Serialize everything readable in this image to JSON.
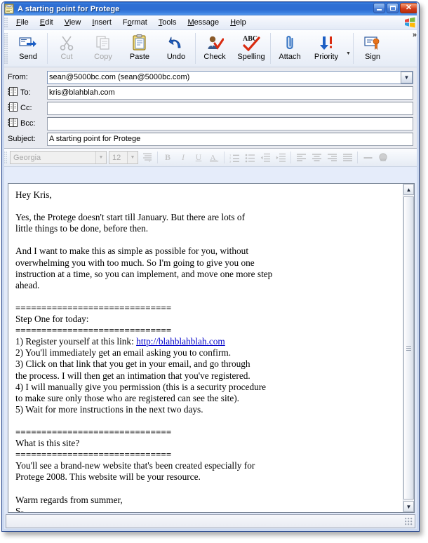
{
  "window": {
    "title": "A starting point for Protege",
    "icon": "mail-compose-icon",
    "controls": {
      "minimize": "minimize-button",
      "maximize": "maximize-button",
      "close": "close-button"
    }
  },
  "menubar": {
    "items": [
      {
        "label": "File",
        "mnemonic": "F"
      },
      {
        "label": "Edit",
        "mnemonic": "E"
      },
      {
        "label": "View",
        "mnemonic": "V"
      },
      {
        "label": "Insert",
        "mnemonic": "I"
      },
      {
        "label": "Format",
        "mnemonic": "o"
      },
      {
        "label": "Tools",
        "mnemonic": "T"
      },
      {
        "label": "Message",
        "mnemonic": "M"
      },
      {
        "label": "Help",
        "mnemonic": "H"
      }
    ],
    "logo": "windows-logo-icon"
  },
  "toolbar": {
    "overflow_label": "»",
    "buttons": [
      {
        "label": "Send",
        "icon": "send-icon",
        "enabled": true
      },
      {
        "label": "Cut",
        "icon": "scissors-icon",
        "enabled": false
      },
      {
        "label": "Copy",
        "icon": "copy-icon",
        "enabled": false
      },
      {
        "label": "Paste",
        "icon": "clipboard-icon",
        "enabled": true
      },
      {
        "label": "Undo",
        "icon": "undo-arrow-icon",
        "enabled": true
      },
      {
        "label": "Check",
        "icon": "check-names-icon",
        "enabled": true
      },
      {
        "label": "Spelling",
        "icon": "spelling-abc-icon",
        "enabled": true
      },
      {
        "label": "Attach",
        "icon": "paperclip-icon",
        "enabled": true
      },
      {
        "label": "Priority",
        "icon": "priority-arrow-icon",
        "enabled": true
      },
      {
        "label": "Sign",
        "icon": "signature-seal-icon",
        "enabled": true
      }
    ]
  },
  "headers": {
    "from": {
      "label": "From:",
      "value": "sean@5000bc.com    (sean@5000bc.com)",
      "placeholder": ""
    },
    "to": {
      "label": "To:",
      "value": "kris@blahblah.com",
      "placeholder": "",
      "icon": "address-book-icon"
    },
    "cc": {
      "label": "Cc:",
      "value": "",
      "placeholder": "",
      "icon": "address-book-icon"
    },
    "bcc": {
      "label": "Bcc:",
      "value": "",
      "placeholder": "",
      "icon": "address-book-icon"
    },
    "subject": {
      "label": "Subject:",
      "value": "A starting point for Protege",
      "placeholder": ""
    }
  },
  "format_toolbar": {
    "font": {
      "value": "Georgia",
      "enabled": false
    },
    "size": {
      "value": "12",
      "enabled": false
    },
    "buttons": [
      {
        "name": "paragraph-style-icon",
        "glyph": "≣"
      },
      {
        "name": "bold-icon",
        "glyph": "B"
      },
      {
        "name": "italic-icon",
        "glyph": "I"
      },
      {
        "name": "underline-icon",
        "glyph": "U"
      },
      {
        "name": "font-color-icon",
        "glyph": "A"
      },
      {
        "name": "numbered-list-icon",
        "glyph": "≣"
      },
      {
        "name": "bulleted-list-icon",
        "glyph": "≣"
      },
      {
        "name": "decrease-indent-icon",
        "glyph": "≡"
      },
      {
        "name": "increase-indent-icon",
        "glyph": "≡"
      },
      {
        "name": "align-left-icon",
        "glyph": "≡"
      },
      {
        "name": "align-center-icon",
        "glyph": "≡"
      },
      {
        "name": "align-right-icon",
        "glyph": "≡"
      },
      {
        "name": "justify-icon",
        "glyph": "≡"
      },
      {
        "name": "horizontal-rule-icon",
        "glyph": "—"
      },
      {
        "name": "insert-picture-icon",
        "glyph": "●"
      }
    ]
  },
  "body": {
    "greeting": "Hey Kris,",
    "para1": "Yes, the Protege doesn't start till January. But there are lots of\nlittle things to be done, before then.",
    "para2": "And I want to make this as simple as possible for you, without\noverwhelming you with too much. So I'm going to give you one\ninstruction at a time, so you can implement, and move one more step\nahead.",
    "divider": "==============================",
    "section1_title": "Step One for today:",
    "step1_prefix": "1) Register yourself at this link: ",
    "step1_link": "http://blahblahblah.com",
    "step2": "2) You'll immediately get an email asking you to confirm.",
    "step3": "3) Click on that link that you get in your email, and go through\nthe process. I will then get an intimation that you've registered.",
    "step4": "4) I will manually give you permission (this is a security procedure\nto make sure only those who are registered can see the site).",
    "step5": "5) Wait for more instructions in the next two days.",
    "section2_title": "What is this site?",
    "para3": "You'll see a brand-new website that's been created especially for\nProtege 2008. This website will be your resource.",
    "signoff": "Warm regards from summer,\nS-"
  },
  "scrollbar": {
    "up_glyph": "▲",
    "down_glyph": "▼"
  },
  "statusbar": {
    "text": ""
  },
  "colors": {
    "title_blue": "#2e6ed3",
    "close_red": "#cf3a18",
    "link_blue": "#0000c8",
    "header_bg": "#e8eaf0",
    "accent_orange": "#e8731a"
  }
}
